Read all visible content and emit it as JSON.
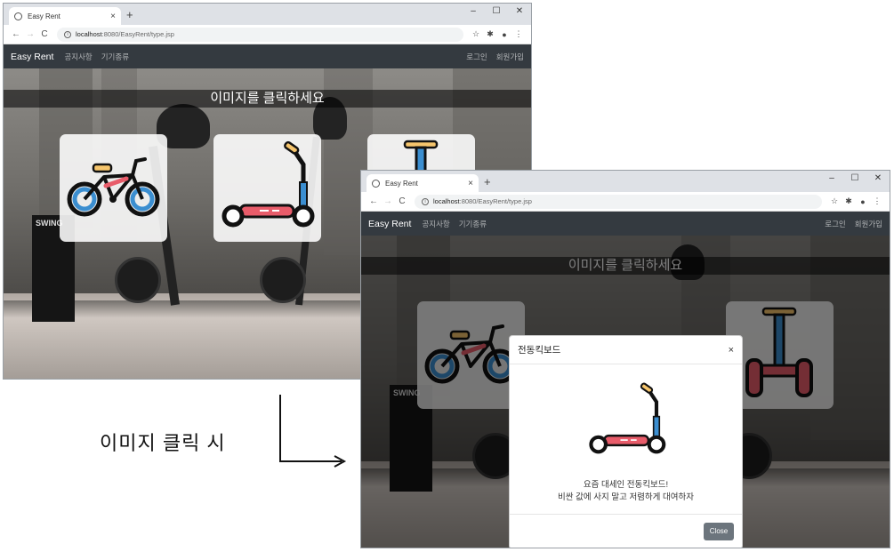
{
  "browser": {
    "tab_title": "Easy Rent",
    "url_host": "localhost",
    "url_rest": ":8080/EasyRent/type.jsp",
    "new_tab": "+",
    "tab_close": "×",
    "minimize": "–",
    "maximize": "☐",
    "close": "✕"
  },
  "navbar": {
    "brand": "Easy Rent",
    "links": [
      "공지사항",
      "기기종류"
    ],
    "right_links": [
      "로그인",
      "회원가입"
    ]
  },
  "banner": "이미지를 클릭하세요",
  "cards": [
    {
      "icon": "bicycle-icon"
    },
    {
      "icon": "electric-scooter-icon"
    },
    {
      "icon": "segway-icon"
    }
  ],
  "modal": {
    "title": "전동킥보드",
    "close_x": "×",
    "line1": "요즘 대세인 전동킥보드!",
    "line2": "비싼 값에 사지 말고 저렴하게 대여하자",
    "close_button": "Close"
  },
  "caption": "이미지 클릭 시",
  "colors": {
    "navbar": "#343a40",
    "accent_blue": "#3b8ed0",
    "accent_yellow": "#f6c56c",
    "accent_red": "#e85c6a",
    "close_button": "#6c757d"
  }
}
